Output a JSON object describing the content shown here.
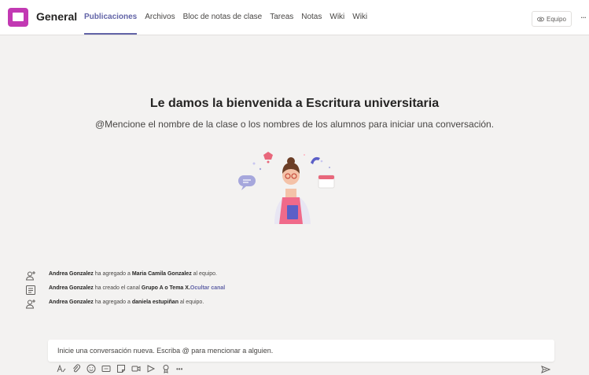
{
  "header": {
    "channel_name": "General",
    "tabs": [
      {
        "label": "Publicaciones",
        "active": true
      },
      {
        "label": "Archivos",
        "active": false
      },
      {
        "label": "Bloc de notas de clase",
        "active": false
      },
      {
        "label": "Tareas",
        "active": false
      },
      {
        "label": "Notas",
        "active": false
      },
      {
        "label": "Wiki",
        "active": false
      },
      {
        "label": "Wiki",
        "active": false
      }
    ],
    "team_button": "Equipo",
    "more": "..."
  },
  "welcome": {
    "title": "Le damos la bienvenida a Escritura universitaria",
    "subtitle": "@Mencione el nombre de la clase o los nombres de los alumnos para iniciar una conversación."
  },
  "activity": [
    {
      "icon": "add-user-icon",
      "actor": "Andrea Gonzalez",
      "text": " ha agregado a ",
      "target": "Maria Camila Gonzalez",
      "suffix": " al equipo.",
      "link": ""
    },
    {
      "icon": "channel-icon",
      "actor": "Andrea  Gonzalez",
      "text": " ha creado el canal ",
      "target": "Grupo A o Tema X",
      "suffix": ".",
      "link": "Ocultar canal"
    },
    {
      "icon": "add-user-icon",
      "actor": "Andrea Gonzalez",
      "text": " ha agregado a ",
      "target": "daniela estupiñan",
      "suffix": " al equipo.",
      "link": ""
    }
  ],
  "composer": {
    "placeholder": "Inicie una conversación nueva. Escriba @ para mencionar a alguien.",
    "toolbar_icons": [
      "format-icon",
      "attach-icon",
      "emoji-icon",
      "gif-icon",
      "sticker-icon",
      "meet-now-icon",
      "stream-icon",
      "praise-icon",
      "more-icon"
    ],
    "more": "•••"
  },
  "colors": {
    "accent": "#6264a7",
    "team_avatar": "#c239b3",
    "background": "#f3f2f1"
  }
}
